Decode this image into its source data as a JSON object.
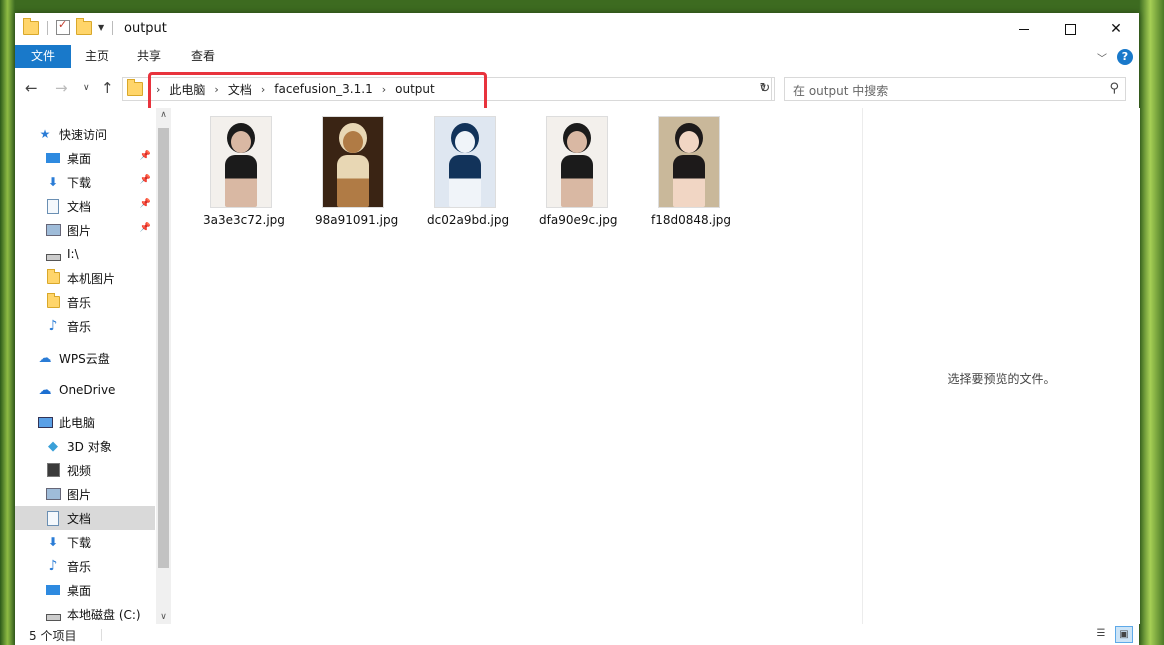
{
  "window": {
    "title": "output",
    "minimize_label": "—",
    "maximize_label": "□",
    "close_label": "✕"
  },
  "ribbon": {
    "tabs": [
      {
        "label": "文件"
      },
      {
        "label": "主页"
      },
      {
        "label": "共享"
      },
      {
        "label": "查看"
      }
    ],
    "help_label": "?"
  },
  "address": {
    "crumbs": [
      "此电脑",
      "文档",
      "facefusion_3.1.1",
      "output"
    ]
  },
  "search": {
    "placeholder": "在 output 中搜索"
  },
  "nav": {
    "items": [
      {
        "label": "快速访问",
        "icon": "star-icon"
      },
      {
        "label": "桌面",
        "icon": "desktop-icon"
      },
      {
        "label": "下载",
        "icon": "download-icon"
      },
      {
        "label": "文档",
        "icon": "document-icon"
      },
      {
        "label": "图片",
        "icon": "picture-icon"
      },
      {
        "label": "I:\\",
        "icon": "drive-icon"
      },
      {
        "label": "本机图片",
        "icon": "folder-icon"
      },
      {
        "label": "音乐",
        "icon": "folder-icon"
      },
      {
        "label": "音乐",
        "icon": "music-icon"
      },
      {
        "label": "WPS云盘",
        "icon": "cloud-icon"
      },
      {
        "label": "OneDrive",
        "icon": "onedrive-icon"
      },
      {
        "label": "此电脑",
        "icon": "computer-icon"
      },
      {
        "label": "3D 对象",
        "icon": "3d-objects-icon"
      },
      {
        "label": "视频",
        "icon": "video-icon"
      },
      {
        "label": "图片",
        "icon": "picture-icon"
      },
      {
        "label": "文档",
        "icon": "document-icon"
      },
      {
        "label": "下载",
        "icon": "download-icon"
      },
      {
        "label": "音乐",
        "icon": "music-icon"
      },
      {
        "label": "桌面",
        "icon": "desktop-icon"
      },
      {
        "label": "本地磁盘 (C:)",
        "icon": "local-disk-icon"
      }
    ]
  },
  "files": [
    {
      "name": "3a3e3c72.jpg",
      "palette": [
        "#f3f0ec",
        "#1b1b1b",
        "#d9b8a3"
      ]
    },
    {
      "name": "98a91091.jpg",
      "palette": [
        "#3a2414",
        "#e8d7b4",
        "#b07b45"
      ]
    },
    {
      "name": "dc02a9bd.jpg",
      "palette": [
        "#dfe7f1",
        "#12335a",
        "#f0f4f9"
      ]
    },
    {
      "name": "dfa90e9c.jpg",
      "palette": [
        "#f3f0ec",
        "#1b1b1b",
        "#d9b8a3"
      ]
    },
    {
      "name": "f18d0848.jpg",
      "palette": [
        "#c9b89a",
        "#1d1a1a",
        "#f1d6c4"
      ]
    }
  ],
  "preview": {
    "message": "选择要预览的文件。"
  },
  "status": {
    "item_count": "5 个项目"
  },
  "colors": {
    "accent": "#1979ca",
    "highlight_border": "#e8333d",
    "selection": "#d9d9d9"
  }
}
